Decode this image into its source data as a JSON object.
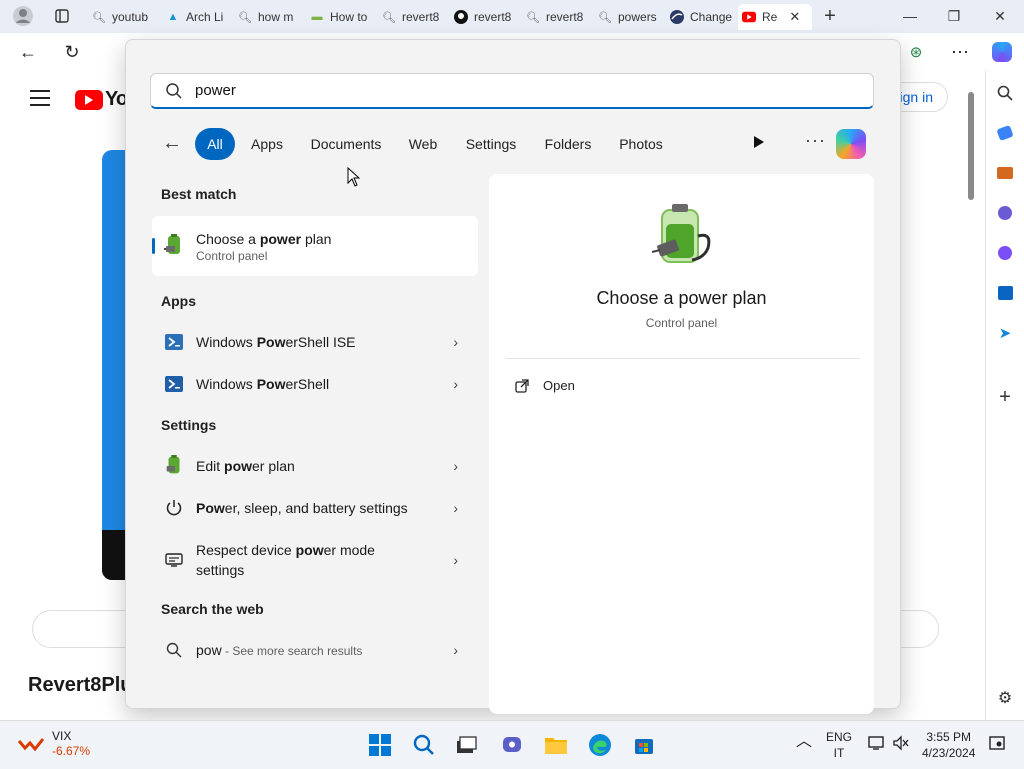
{
  "browser": {
    "tabs": [
      {
        "label": "youtub",
        "icon": "search-icon"
      },
      {
        "label": "Arch Li",
        "icon": "arch-icon"
      },
      {
        "label": "how m",
        "icon": "search-icon"
      },
      {
        "label": "How to",
        "icon": "page-icon"
      },
      {
        "label": "revert8",
        "icon": "search-icon"
      },
      {
        "label": "revert8",
        "icon": "github-icon"
      },
      {
        "label": "revert8",
        "icon": "search-icon"
      },
      {
        "label": "powers",
        "icon": "search-icon"
      },
      {
        "label": "Change",
        "icon": "site-icon"
      },
      {
        "label": "Re",
        "icon": "youtube-icon"
      }
    ]
  },
  "youtube": {
    "logo_text": "Yo",
    "sign_in": "ign in",
    "channel": "Revert8Plu"
  },
  "search": {
    "query": "power",
    "filters": [
      "All",
      "Apps",
      "Documents",
      "Web",
      "Settings",
      "Folders",
      "Photos"
    ],
    "selected_filter": "All",
    "best_match_heading": "Best match",
    "best_match": {
      "pre": "Choose a ",
      "bold": "power",
      "post": " plan",
      "sub": "Control panel"
    },
    "apps_heading": "Apps",
    "apps": [
      {
        "pre": "Windows ",
        "bold": "Pow",
        "post": "erShell ISE"
      },
      {
        "pre": "Windows ",
        "bold": "Pow",
        "post": "erShell"
      }
    ],
    "settings_heading": "Settings",
    "settings": [
      {
        "pre": "Edit ",
        "bold": "pow",
        "post": "er plan"
      },
      {
        "pre": "",
        "bold": "Pow",
        "post": "er, sleep, and battery settings"
      },
      {
        "pre": "Respect device ",
        "bold": "pow",
        "post": "er mode",
        "line2": "settings"
      }
    ],
    "web_heading": "Search the web",
    "web": {
      "term": "pow",
      "hint": " - See more search results"
    },
    "preview": {
      "title": "Choose a power plan",
      "sub": "Control panel",
      "open_label": "Open"
    }
  },
  "taskbar": {
    "vix_label": "VIX",
    "vix_change": "-6.67%",
    "lang_top": "ENG",
    "lang_bottom": "IT",
    "time": "3:55 PM",
    "date": "4/23/2024"
  },
  "colors": {
    "accent": "#0067c0",
    "youtube_red": "#ff0000",
    "vix_red": "#d83b01"
  }
}
